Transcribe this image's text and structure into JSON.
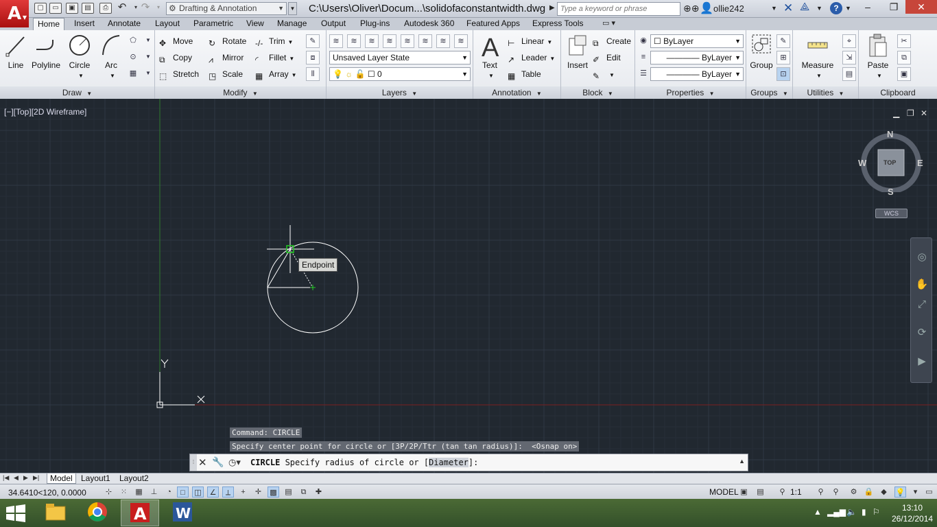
{
  "titlebar": {
    "workspace": "Drafting & Annotation",
    "document_title": "C:\\Users\\Oliver\\Docum...\\solidofaconstantwidth.dwg",
    "search_placeholder": "Type a keyword or phrase",
    "user_name": "ollie242",
    "help_label": "?",
    "app_logo_letter": "A"
  },
  "tabs": [
    {
      "label": "Home",
      "active": true
    },
    {
      "label": "Insert"
    },
    {
      "label": "Annotate"
    },
    {
      "label": "Layout"
    },
    {
      "label": "Parametric"
    },
    {
      "label": "View"
    },
    {
      "label": "Manage"
    },
    {
      "label": "Output"
    },
    {
      "label": "Plug-ins"
    },
    {
      "label": "Autodesk 360"
    },
    {
      "label": "Featured Apps"
    },
    {
      "label": "Express Tools"
    }
  ],
  "ribbon": {
    "draw": {
      "title": "Draw",
      "line": "Line",
      "polyline": "Polyline",
      "circle": "Circle",
      "arc": "Arc"
    },
    "modify": {
      "title": "Modify",
      "move": "Move",
      "rotate": "Rotate",
      "trim": "Trim",
      "copy": "Copy",
      "mirror": "Mirror",
      "fillet": "Fillet",
      "stretch": "Stretch",
      "scale": "Scale",
      "array": "Array"
    },
    "layers": {
      "title": "Layers",
      "layer_state": "Unsaved Layer State",
      "current_layer": "0"
    },
    "annotation": {
      "title": "Annotation",
      "text": "Text",
      "linear": "Linear",
      "leader": "Leader",
      "table": "Table"
    },
    "block": {
      "title": "Block",
      "insert": "Insert",
      "create": "Create",
      "edit": "Edit"
    },
    "properties": {
      "title": "Properties",
      "color": "ByLayer",
      "linetype": "ByLayer",
      "lineweight": "ByLayer"
    },
    "groups": {
      "title": "Groups",
      "group": "Group"
    },
    "utilities": {
      "title": "Utilities",
      "measure": "Measure"
    },
    "clipboard": {
      "title": "Clipboard",
      "paste": "Paste"
    }
  },
  "viewport": {
    "label": "[−][Top][2D Wireframe]",
    "compass": {
      "n": "N",
      "s": "S",
      "e": "E",
      "w": "W",
      "top": "TOP"
    },
    "wcs": "WCS",
    "tooltip": "Endpoint",
    "ucs_x": "X",
    "ucs_y": "Y",
    "command_history": [
      "Command: CIRCLE",
      "Specify center point for circle or [3P/2P/Ttr (tan tan radius)]:  <Osnap on>"
    ]
  },
  "command_line": {
    "prefix": "CIRCLE",
    "prompt": " Specify radius of circle or [",
    "option": "Diameter",
    "suffix": "]:"
  },
  "layout_tabs": [
    {
      "label": "Model",
      "active": true
    },
    {
      "label": "Layout1"
    },
    {
      "label": "Layout2"
    }
  ],
  "statusbar": {
    "coords": "34.6410<120, 0.0000",
    "model": "MODEL",
    "scale": "1:1"
  },
  "taskbar": {
    "time": "13:10",
    "date": "26/12/2014"
  },
  "colors": {
    "canvas": "#212830",
    "grid_major": "#2f3945",
    "grid_minor": "#262e38",
    "ucs_y_axis": "#2e7a2e",
    "ucs_x_axis": "#7a2020",
    "entity": "#ffffff",
    "osnap_marker": "#22cc22"
  }
}
